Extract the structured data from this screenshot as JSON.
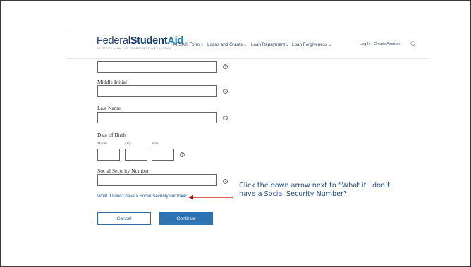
{
  "header": {
    "logo": {
      "federal": "Federal",
      "student": "Student",
      "aid": "Aid",
      "tagline": "AN OFFICE of the U.S. DEPARTMENT of EDUCATION"
    },
    "nav": [
      {
        "label": "FAFSA® Form"
      },
      {
        "label": "Loans and Grants"
      },
      {
        "label": "Loan Repayment"
      },
      {
        "label": "Loan Forgiveness"
      }
    ],
    "login": "Log In",
    "separator": "|",
    "create_account": "Create Account"
  },
  "form": {
    "first_name_value": "",
    "middle_initial_label": "Middle Initial",
    "middle_initial_value": "",
    "last_name_label": "Last Name",
    "last_name_value": "",
    "dob_label": "Date of Birth",
    "month_label": "Month",
    "day_label": "Day",
    "year_label": "Year",
    "month_value": "",
    "day_value": "",
    "year_value": "",
    "ssn_label": "Social Security Number",
    "ssn_value": "",
    "help_glyph": "?",
    "no_ssn_link": "What if I don't have a Social Security number?"
  },
  "buttons": {
    "cancel": "Cancel",
    "continue": "Continue"
  },
  "annotation": {
    "line1": "Click the down arrow next to “What if I don’t",
    "line2": "have a Social Security Number?",
    "arrow_color": "#c00000"
  }
}
